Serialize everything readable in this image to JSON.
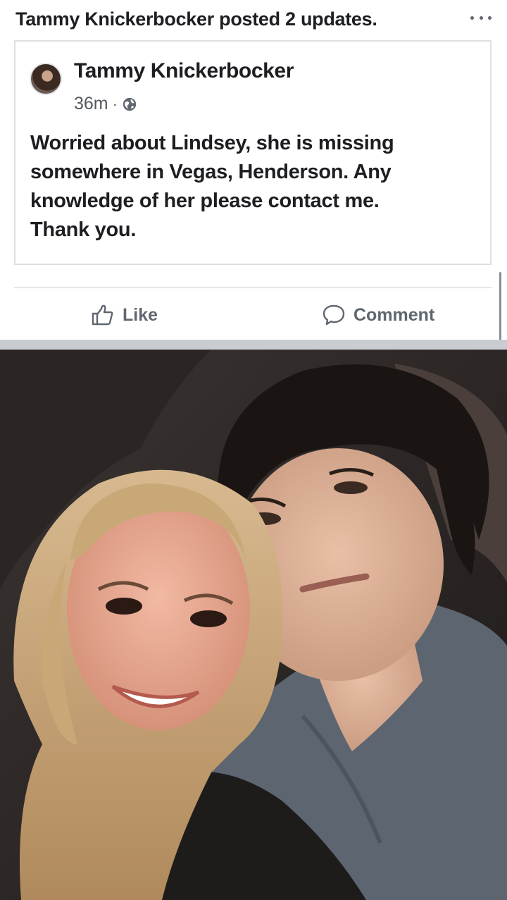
{
  "header": {
    "title": "Tammy Knickerbocker posted 2 updates.",
    "more_icon": "ellipsis-icon"
  },
  "shared_post": {
    "author": "Tammy Knickerbocker",
    "timestamp": "36m",
    "separator": "·",
    "privacy_icon": "globe-icon",
    "text": "Worried about Lindsey, she is missing\nsomewhere in Vegas, Henderson.  Any\nknowledge of her please contact me.\nThank you."
  },
  "actions": {
    "like_label": "Like",
    "comment_label": "Comment"
  },
  "colors": {
    "text": "#1c1e21",
    "secondary_text": "#606770",
    "divider": "#e4e6eb",
    "band": "#c9ccd1"
  }
}
